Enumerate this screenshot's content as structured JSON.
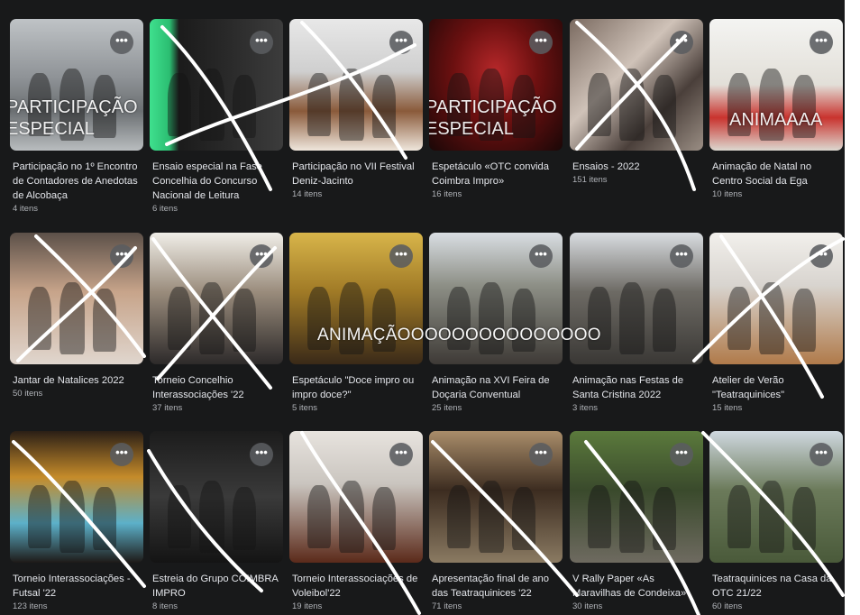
{
  "albums": [
    {
      "title": "Participação no 1º Encontro de Contadores de Anedotas de Alcobaça",
      "count": "4 itens",
      "overlay": "PARTICIPAÇÃO ESPECIAL"
    },
    {
      "title": "Ensaio especial na Fase Concelhia do Concurso Nacional de Leitura",
      "count": "6 itens",
      "overlay": ""
    },
    {
      "title": "Participação no VII Festival Deniz-Jacinto",
      "count": "14 itens",
      "overlay": ""
    },
    {
      "title": "Espetáculo «OTC convida Coimbra Impro»",
      "count": "16 itens",
      "overlay": "PARTICIPAÇÃO ESPECIAL"
    },
    {
      "title": "Ensaios - 2022",
      "count": "151 itens",
      "overlay": ""
    },
    {
      "title": "Animação de Natal no Centro Social da Ega",
      "count": "10 itens",
      "overlay": "ANIMAAAA"
    },
    {
      "title": "Jantar de Natalices 2022",
      "count": "50 itens",
      "overlay": ""
    },
    {
      "title": "Torneio Concelhio Interassociações '22",
      "count": "37 itens",
      "overlay": ""
    },
    {
      "title": "Espetáculo \"Doce impro ou impro doce?\"",
      "count": "5 itens",
      "overlay": ""
    },
    {
      "title": "Animação na XVI Feira de Doçaria Conventual",
      "count": "25 itens",
      "overlay": ""
    },
    {
      "title": "Animação nas Festas de Santa Cristina 2022",
      "count": "3 itens",
      "overlay": ""
    },
    {
      "title": "Atelier de Verão \"Teatraquinices\"",
      "count": "15 itens",
      "overlay": ""
    },
    {
      "title": "Torneio Interassociações - Futsal '22",
      "count": "123 itens",
      "overlay": ""
    },
    {
      "title": "Estreia do Grupo COIMBRA IMPRO",
      "count": "8 itens",
      "overlay": ""
    },
    {
      "title": "Torneio Interassociações de Voleibol'22",
      "count": "19 itens",
      "overlay": ""
    },
    {
      "title": "Apresentação final de ano das Teatraquinices '22",
      "count": "71 itens",
      "overlay": ""
    },
    {
      "title": "V Rally Paper «As Maravilhas de Condeixa»",
      "count": "30 itens",
      "overlay": ""
    },
    {
      "title": "Teatraquinices na Casa da OTC 21/22",
      "count": "60 itens",
      "overlay": ""
    }
  ],
  "annotations": {
    "spanning_overlay": "ANIMAÇÃOOOOOOOOOOOOOOO"
  },
  "ui": {
    "more_icon_glyph": "•••"
  },
  "colors": {
    "background": "#18191a",
    "title_text": "#e4e6eb",
    "count_text": "#b0b3b8",
    "more_button": "#5a5c60"
  }
}
